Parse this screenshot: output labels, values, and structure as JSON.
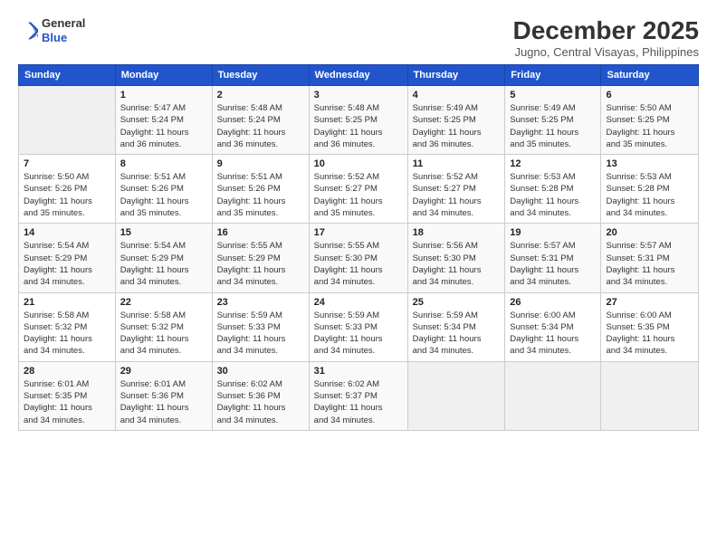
{
  "logo": {
    "general": "General",
    "blue": "Blue"
  },
  "header": {
    "month": "December 2025",
    "location": "Jugno, Central Visayas, Philippines"
  },
  "days_of_week": [
    "Sunday",
    "Monday",
    "Tuesday",
    "Wednesday",
    "Thursday",
    "Friday",
    "Saturday"
  ],
  "weeks": [
    [
      {
        "day": "",
        "info": ""
      },
      {
        "day": "1",
        "info": "Sunrise: 5:47 AM\nSunset: 5:24 PM\nDaylight: 11 hours\nand 36 minutes."
      },
      {
        "day": "2",
        "info": "Sunrise: 5:48 AM\nSunset: 5:24 PM\nDaylight: 11 hours\nand 36 minutes."
      },
      {
        "day": "3",
        "info": "Sunrise: 5:48 AM\nSunset: 5:25 PM\nDaylight: 11 hours\nand 36 minutes."
      },
      {
        "day": "4",
        "info": "Sunrise: 5:49 AM\nSunset: 5:25 PM\nDaylight: 11 hours\nand 36 minutes."
      },
      {
        "day": "5",
        "info": "Sunrise: 5:49 AM\nSunset: 5:25 PM\nDaylight: 11 hours\nand 35 minutes."
      },
      {
        "day": "6",
        "info": "Sunrise: 5:50 AM\nSunset: 5:25 PM\nDaylight: 11 hours\nand 35 minutes."
      }
    ],
    [
      {
        "day": "7",
        "info": "Sunrise: 5:50 AM\nSunset: 5:26 PM\nDaylight: 11 hours\nand 35 minutes."
      },
      {
        "day": "8",
        "info": "Sunrise: 5:51 AM\nSunset: 5:26 PM\nDaylight: 11 hours\nand 35 minutes."
      },
      {
        "day": "9",
        "info": "Sunrise: 5:51 AM\nSunset: 5:26 PM\nDaylight: 11 hours\nand 35 minutes."
      },
      {
        "day": "10",
        "info": "Sunrise: 5:52 AM\nSunset: 5:27 PM\nDaylight: 11 hours\nand 35 minutes."
      },
      {
        "day": "11",
        "info": "Sunrise: 5:52 AM\nSunset: 5:27 PM\nDaylight: 11 hours\nand 34 minutes."
      },
      {
        "day": "12",
        "info": "Sunrise: 5:53 AM\nSunset: 5:28 PM\nDaylight: 11 hours\nand 34 minutes."
      },
      {
        "day": "13",
        "info": "Sunrise: 5:53 AM\nSunset: 5:28 PM\nDaylight: 11 hours\nand 34 minutes."
      }
    ],
    [
      {
        "day": "14",
        "info": "Sunrise: 5:54 AM\nSunset: 5:29 PM\nDaylight: 11 hours\nand 34 minutes."
      },
      {
        "day": "15",
        "info": "Sunrise: 5:54 AM\nSunset: 5:29 PM\nDaylight: 11 hours\nand 34 minutes."
      },
      {
        "day": "16",
        "info": "Sunrise: 5:55 AM\nSunset: 5:29 PM\nDaylight: 11 hours\nand 34 minutes."
      },
      {
        "day": "17",
        "info": "Sunrise: 5:55 AM\nSunset: 5:30 PM\nDaylight: 11 hours\nand 34 minutes."
      },
      {
        "day": "18",
        "info": "Sunrise: 5:56 AM\nSunset: 5:30 PM\nDaylight: 11 hours\nand 34 minutes."
      },
      {
        "day": "19",
        "info": "Sunrise: 5:57 AM\nSunset: 5:31 PM\nDaylight: 11 hours\nand 34 minutes."
      },
      {
        "day": "20",
        "info": "Sunrise: 5:57 AM\nSunset: 5:31 PM\nDaylight: 11 hours\nand 34 minutes."
      }
    ],
    [
      {
        "day": "21",
        "info": "Sunrise: 5:58 AM\nSunset: 5:32 PM\nDaylight: 11 hours\nand 34 minutes."
      },
      {
        "day": "22",
        "info": "Sunrise: 5:58 AM\nSunset: 5:32 PM\nDaylight: 11 hours\nand 34 minutes."
      },
      {
        "day": "23",
        "info": "Sunrise: 5:59 AM\nSunset: 5:33 PM\nDaylight: 11 hours\nand 34 minutes."
      },
      {
        "day": "24",
        "info": "Sunrise: 5:59 AM\nSunset: 5:33 PM\nDaylight: 11 hours\nand 34 minutes."
      },
      {
        "day": "25",
        "info": "Sunrise: 5:59 AM\nSunset: 5:34 PM\nDaylight: 11 hours\nand 34 minutes."
      },
      {
        "day": "26",
        "info": "Sunrise: 6:00 AM\nSunset: 5:34 PM\nDaylight: 11 hours\nand 34 minutes."
      },
      {
        "day": "27",
        "info": "Sunrise: 6:00 AM\nSunset: 5:35 PM\nDaylight: 11 hours\nand 34 minutes."
      }
    ],
    [
      {
        "day": "28",
        "info": "Sunrise: 6:01 AM\nSunset: 5:35 PM\nDaylight: 11 hours\nand 34 minutes."
      },
      {
        "day": "29",
        "info": "Sunrise: 6:01 AM\nSunset: 5:36 PM\nDaylight: 11 hours\nand 34 minutes."
      },
      {
        "day": "30",
        "info": "Sunrise: 6:02 AM\nSunset: 5:36 PM\nDaylight: 11 hours\nand 34 minutes."
      },
      {
        "day": "31",
        "info": "Sunrise: 6:02 AM\nSunset: 5:37 PM\nDaylight: 11 hours\nand 34 minutes."
      },
      {
        "day": "",
        "info": ""
      },
      {
        "day": "",
        "info": ""
      },
      {
        "day": "",
        "info": ""
      }
    ]
  ]
}
